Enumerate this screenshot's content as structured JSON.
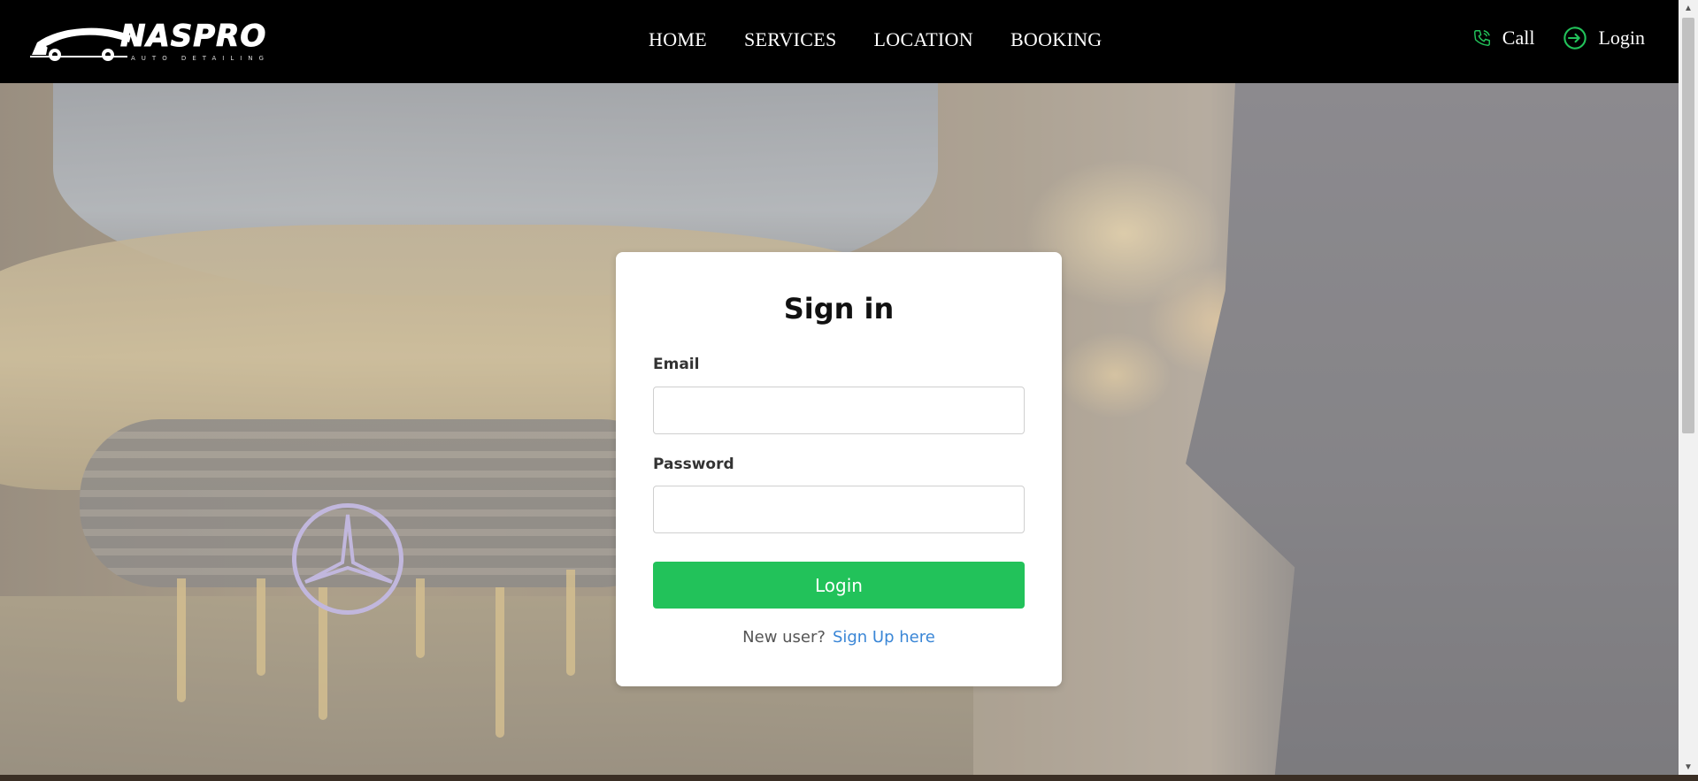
{
  "brand": {
    "name": "NASPRO",
    "tagline": "AUTO DETAILING"
  },
  "nav": [
    {
      "label": "HOME"
    },
    {
      "label": "SERVICES"
    },
    {
      "label": "LOCATION"
    },
    {
      "label": "BOOKING"
    }
  ],
  "actions": {
    "call": {
      "label": "Call",
      "icon": "phone-icon"
    },
    "login": {
      "label": "Login",
      "icon": "login-icon"
    }
  },
  "signin": {
    "title": "Sign in",
    "email_label": "Email",
    "email_value": "",
    "password_label": "Password",
    "password_value": "",
    "submit_label": "Login",
    "new_user_text": "New user?",
    "signup_link": "Sign Up here"
  },
  "colors": {
    "header_bg": "#000000",
    "accent_green": "#22c25a",
    "link_blue": "#3a86d6"
  }
}
